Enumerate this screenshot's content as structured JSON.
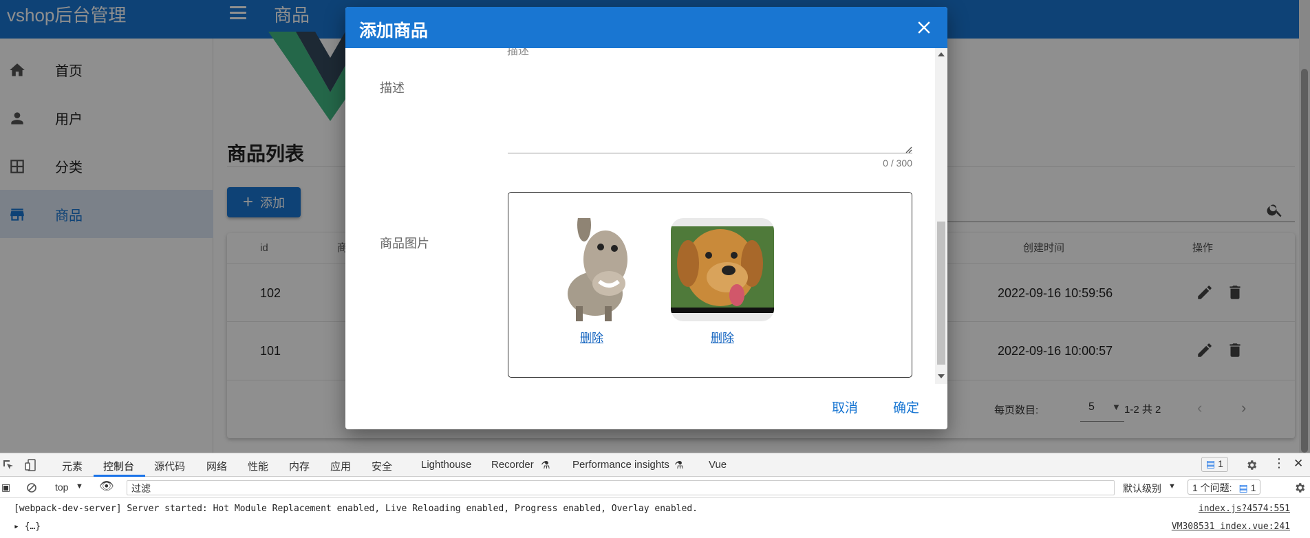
{
  "app": {
    "brand": "vshop后台管理",
    "page_title": "商品"
  },
  "sidebar": {
    "items": [
      {
        "label": "首页",
        "icon": "home-icon"
      },
      {
        "label": "用户",
        "icon": "person-icon"
      },
      {
        "label": "分类",
        "icon": "grid-icon"
      },
      {
        "label": "商品",
        "icon": "store-icon",
        "active": true
      }
    ]
  },
  "main": {
    "section_title": "商品列表",
    "add_button": "添加"
  },
  "table": {
    "headers": {
      "id": "id",
      "name_fragment": "商",
      "created": "创建时间",
      "actions": "操作"
    },
    "rows": [
      {
        "id": "102",
        "created": "2022-09-16 10:59:56"
      },
      {
        "id": "101",
        "created": "2022-09-16 10:00:57"
      }
    ],
    "footer": {
      "per_page_label": "每页数目:",
      "per_page_value": "5",
      "range": "1-2 共 2"
    }
  },
  "dialog": {
    "title": "添加商品",
    "clipped_label": "描述",
    "description_label": "描述",
    "description_value": "",
    "counter": "0 / 300",
    "images_label": "商品图片",
    "images": [
      {
        "alt": "donkey",
        "delete_label": "删除"
      },
      {
        "alt": "dog",
        "delete_label": "删除"
      }
    ],
    "cancel": "取消",
    "confirm": "确定"
  },
  "devtools": {
    "tabs": [
      "元素",
      "控制台",
      "源代码",
      "网络",
      "性能",
      "内存",
      "应用",
      "安全",
      "Lighthouse",
      "Recorder",
      "Performance insights",
      "Vue"
    ],
    "active_tab": "控制台",
    "message_badge": "1",
    "context": "top",
    "filter_placeholder": "过滤",
    "level": "默认级别",
    "issues_label": "1 个问题:",
    "issues_count": "1",
    "logs": [
      {
        "text": "[webpack-dev-server] Server started: Hot Module Replacement enabled, Live Reloading enabled, Progress enabled, Overlay enabled.",
        "source": "index.js?4574:551"
      },
      {
        "text": "▸ {…}",
        "source": "VM308531 index.vue:241"
      }
    ]
  },
  "colors": {
    "primary": "#1976d2",
    "overlay": "rgba(0,0,0,0.44)"
  }
}
